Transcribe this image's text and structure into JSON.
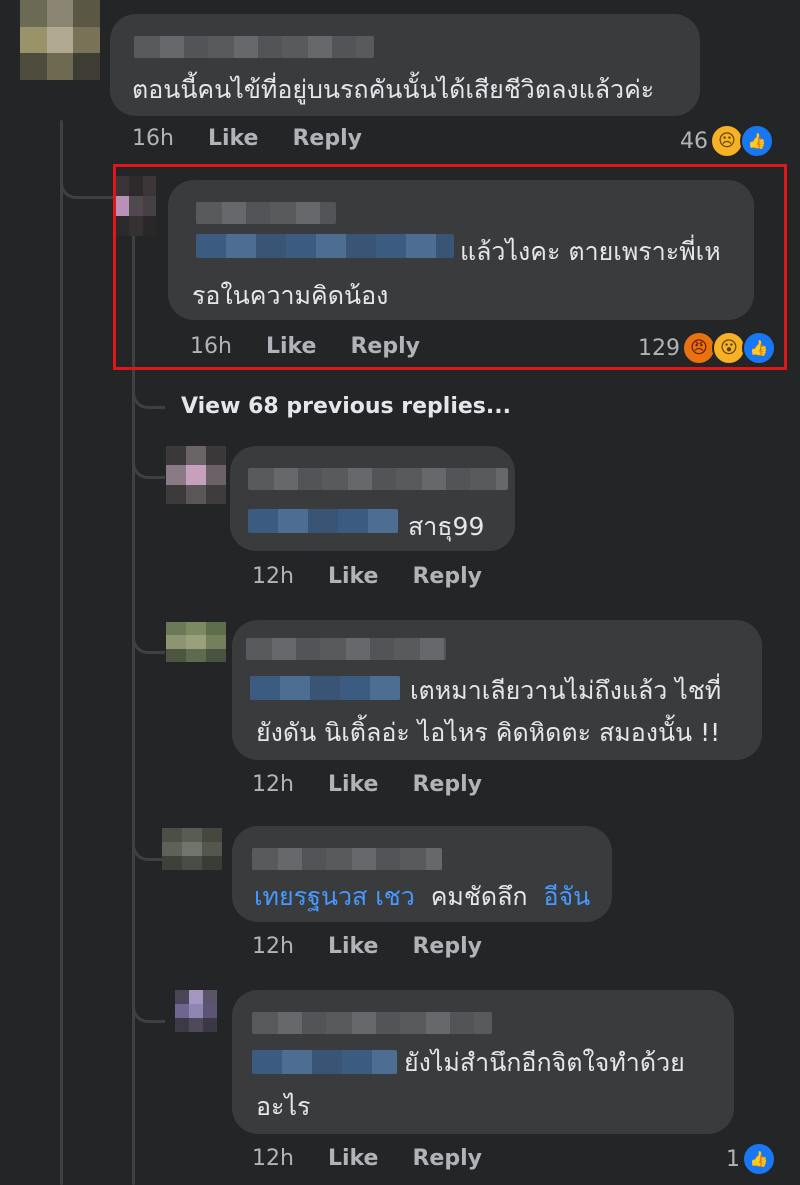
{
  "comments": [
    {
      "text_lines": [
        "ตอนนี้คนไข้ที่อยู่บนรถคันนั้นได้เสียชีวิตลงแล้วค่ะ"
      ],
      "time": "16h",
      "like": "Like",
      "reply": "Reply",
      "reaction_count": "46",
      "reactions": [
        "sad-icon",
        "like-icon"
      ]
    },
    {
      "text_lines": [
        "แล้วไงคะ ตายเพราะพี่เห",
        "รอในความคิดน้อง"
      ],
      "time": "16h",
      "like": "Like",
      "reply": "Reply",
      "reaction_count": "129",
      "reactions": [
        "angry-icon",
        "wow-icon",
        "like-icon"
      ],
      "highlight_color": "#e0161b"
    }
  ],
  "view_previous": "View 68 previous replies...",
  "replies": [
    {
      "text_lines": [
        "สาธุ99"
      ],
      "time": "12h",
      "like": "Like",
      "reply": "Reply"
    },
    {
      "text_lines": [
        "เตหมาเลียวานไม่ถึงแล้ว ไชที่",
        "ยังดัน นิเติ้ลอ่ะ ไอไหร  คิดหิดตะ สมองนั้น !!"
      ],
      "time": "12h",
      "like": "Like",
      "reply": "Reply"
    },
    {
      "mention1": "เทยรฐนวส เชว",
      "text": "คมชัดลึก",
      "mention2": "อีจัน",
      "time": "12h",
      "like": "Like",
      "reply": "Reply"
    },
    {
      "text_lines": [
        "ยังไม่สำนึกอีกจิตใจทำด้วย",
        "อะไร"
      ],
      "time": "12h",
      "like": "Like",
      "reply": "Reply",
      "reaction_count": "1",
      "reactions": [
        "like-icon"
      ]
    }
  ],
  "colors": {
    "background": "#242526",
    "bubble": "#3a3b3c",
    "text": "#e4e6eb",
    "meta": "#b0b3b8",
    "link": "#4599ff",
    "like_blue": "#1877f2"
  }
}
